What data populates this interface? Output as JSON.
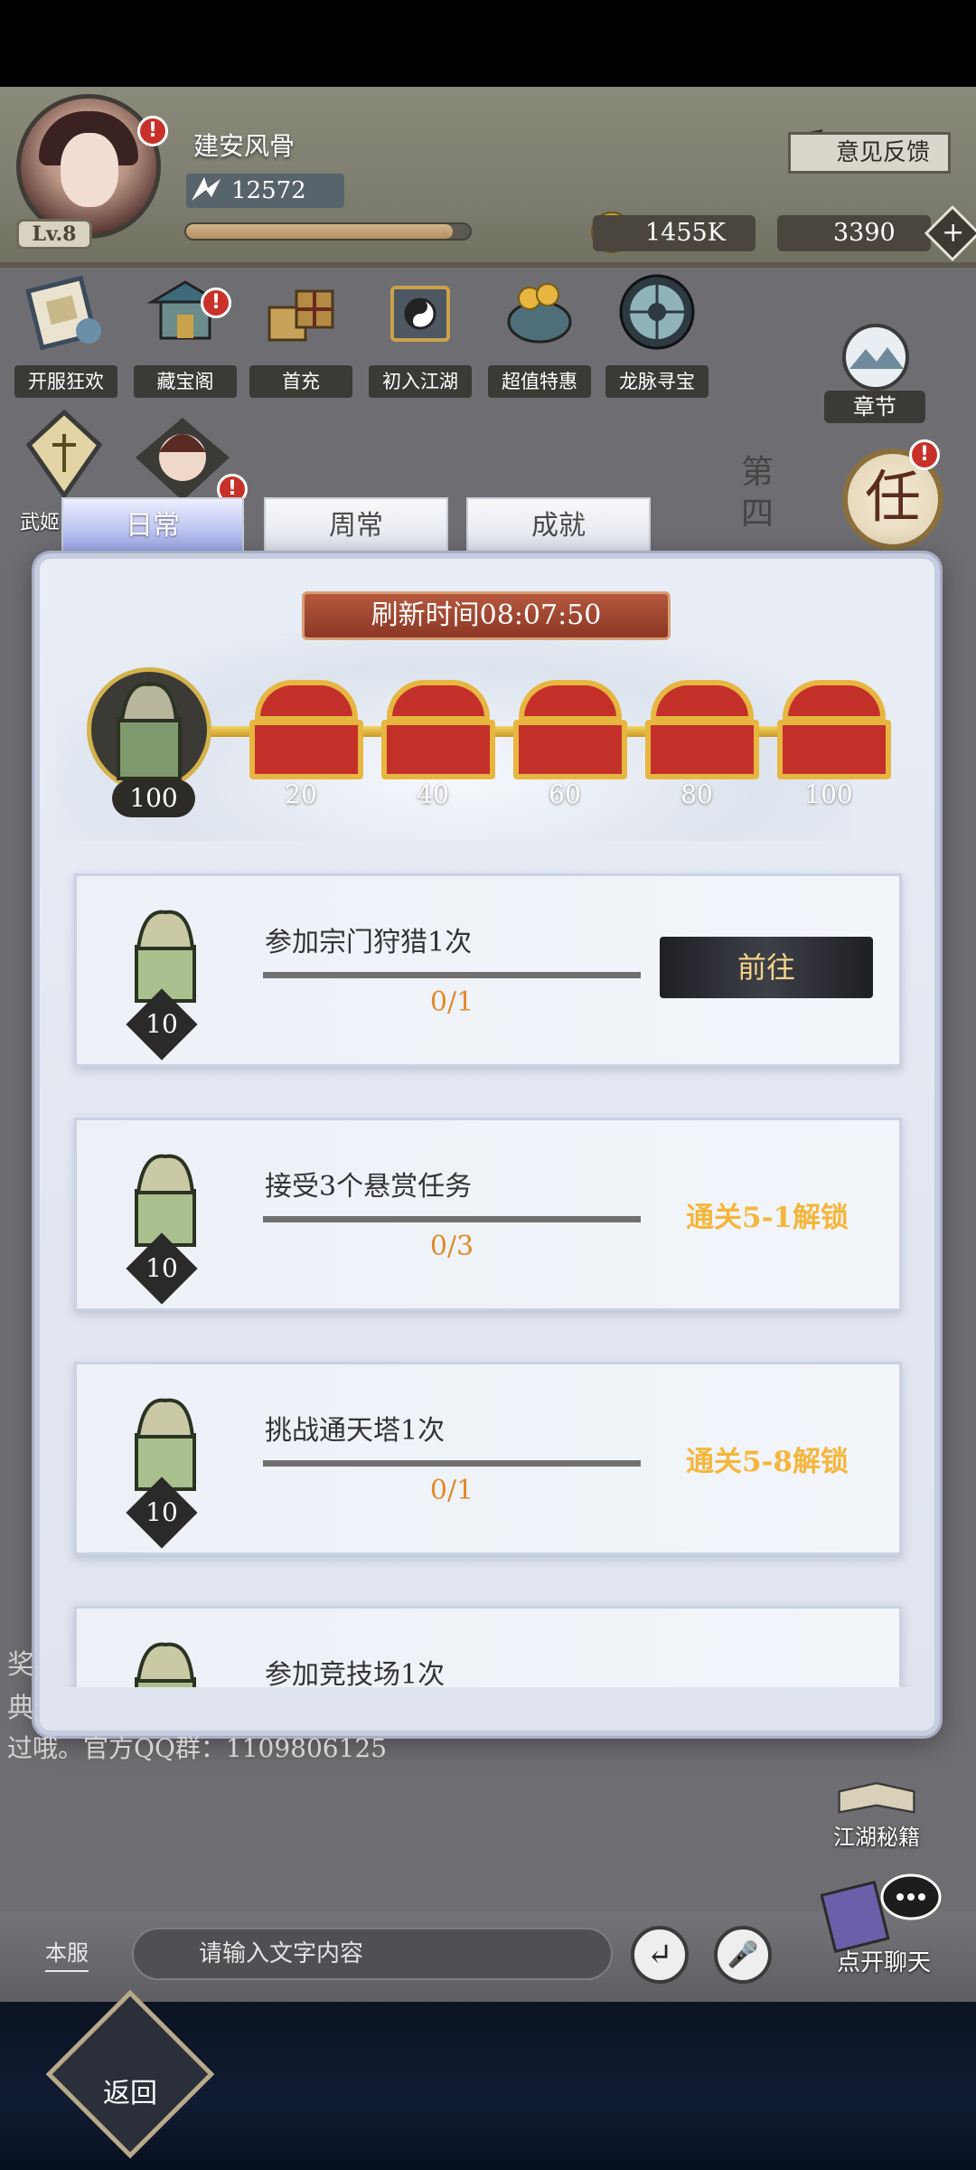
{
  "player": {
    "name": "建安风骨",
    "level": "Lv.8",
    "power": "12572",
    "exp_fraction": 0.94
  },
  "header": {
    "feedback_label": "意见反馈",
    "coins": "1455K",
    "ingots": "3390",
    "plus": "+"
  },
  "activities": [
    {
      "label": "开服狂欢",
      "icon": "scroll-celebration-icon",
      "alert": false
    },
    {
      "label": "藏宝阁",
      "icon": "treasure-pavilion-icon",
      "alert": true
    },
    {
      "label": "首充",
      "icon": "gift-boxes-icon",
      "alert": false
    },
    {
      "label": "初入江湖",
      "icon": "yin-yang-box-icon",
      "alert": false
    },
    {
      "label": "超值特惠",
      "icon": "money-pot-icon",
      "alert": false
    },
    {
      "label": "龙脉寻宝",
      "icon": "compass-icon",
      "alert": false
    }
  ],
  "row2": {
    "label_fragment": "武姬"
  },
  "chapter": {
    "label": "章节"
  },
  "quest_button": {
    "label": "任"
  },
  "side_text": "第四",
  "tabs": [
    {
      "label": "日常",
      "active": true
    },
    {
      "label": "周常",
      "active": false
    },
    {
      "label": "成就",
      "active": false
    }
  ],
  "refresh": {
    "label": "刷新时间08:07:50"
  },
  "activity_track": {
    "current": "100",
    "milestones": [
      "20",
      "40",
      "60",
      "80",
      "100"
    ]
  },
  "tasks": [
    {
      "title": "参加宗门狩猎1次",
      "progress": "0/1",
      "reward": "10",
      "action": "前往",
      "locked": false
    },
    {
      "title": "接受3个悬赏任务",
      "progress": "0/3",
      "reward": "10",
      "action": "通关5-1解锁",
      "locked": true
    },
    {
      "title": "挑战通天塔1次",
      "progress": "0/1",
      "reward": "10",
      "action": "通关5-8解锁",
      "locked": true
    },
    {
      "title": "参加竞技场1次",
      "progress": "",
      "reward": "",
      "action": "",
      "locked": false
    }
  ],
  "chat": {
    "left_fragments": [
      "奖",
      "典"
    ],
    "visible_line": "过哦。官方QQ群：1109806125",
    "server_label": "本服",
    "input_placeholder": "请输入文字内容",
    "enter_icon": "↵",
    "mic_icon": "🎤"
  },
  "side_buttons": {
    "secrets_label": "江湖秘籍",
    "chat_label": "点开聊天"
  },
  "bottom": {
    "back_label": "返回"
  },
  "colors": {
    "accent_gold": "#f4b63c",
    "progress_orange": "#e08a2a",
    "alert_red": "#c8312a",
    "refresh_red": "#8b3725"
  }
}
